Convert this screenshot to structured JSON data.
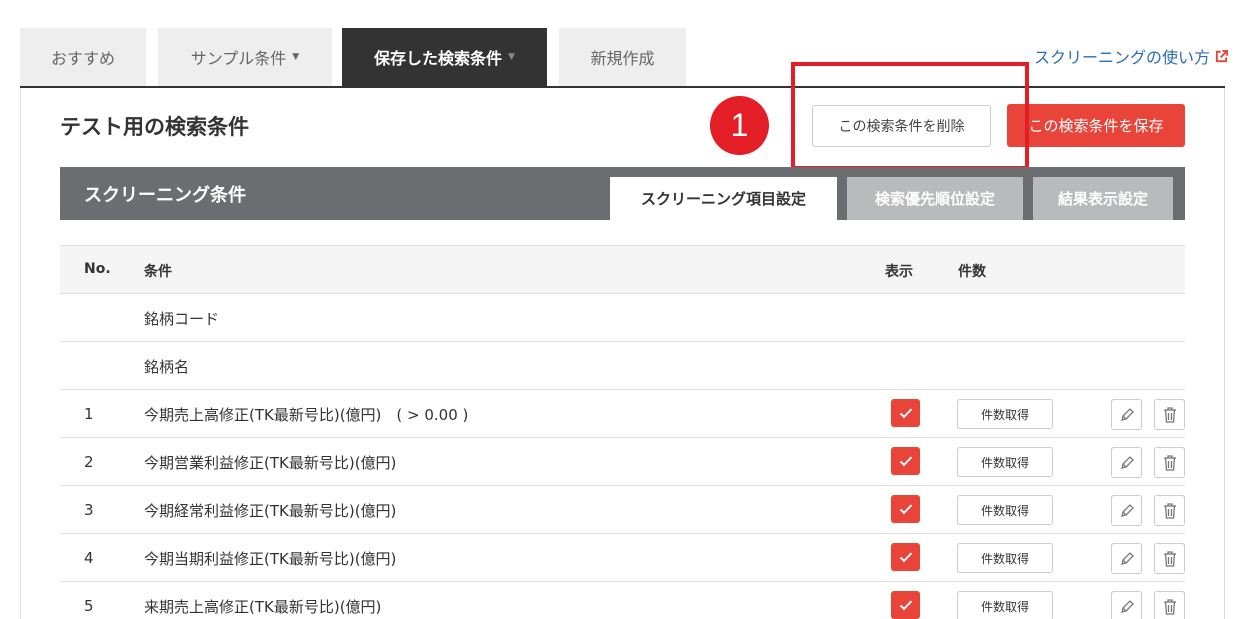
{
  "top_tabs": [
    {
      "label": "おすすめ"
    },
    {
      "label": "サンプル条件"
    },
    {
      "label": "保存した検索条件"
    },
    {
      "label": "新規作成"
    }
  ],
  "help_link": "スクリーニングの使い方",
  "page_title": "テスト用の検索条件",
  "badge_number": "1",
  "actions": {
    "delete": "この検索条件を削除",
    "save": "この検索条件を保存"
  },
  "screening": {
    "title": "スクリーニング条件",
    "tabs": [
      {
        "label": "スクリーニング項目設定"
      },
      {
        "label": "検索優先順位設定"
      },
      {
        "label": "結果表示設定"
      }
    ]
  },
  "table": {
    "headers": {
      "no": "No.",
      "condition": "条件",
      "display": "表示",
      "count": "件数"
    },
    "fixed_rows": [
      "銘柄コード",
      "銘柄名"
    ],
    "rows": [
      {
        "no": "1",
        "condition": "今期売上高修正(TK最新号比)(億円)　( > 0.00 )"
      },
      {
        "no": "2",
        "condition": "今期営業利益修正(TK最新号比)(億円)"
      },
      {
        "no": "3",
        "condition": "今期経常利益修正(TK最新号比)(億円)"
      },
      {
        "no": "4",
        "condition": "今期当期利益修正(TK最新号比)(億円)"
      },
      {
        "no": "5",
        "condition": "来期売上高修正(TK最新号比)(億円)"
      }
    ],
    "count_button_label": "件数取得"
  },
  "colors": {
    "accent": "#e8443a",
    "dark_tab": "#333333",
    "link": "#2a6db3",
    "highlight": "#e41e26"
  }
}
